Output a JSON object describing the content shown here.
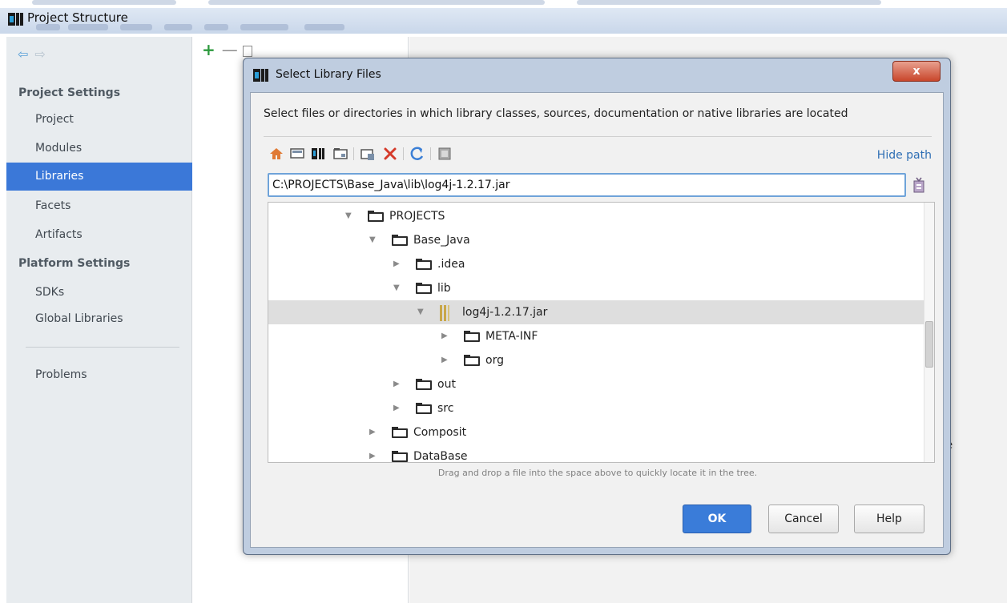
{
  "window": {
    "title": "Project Structure"
  },
  "sidebar": {
    "project_settings_header": "Project Settings",
    "platform_settings_header": "Platform Settings",
    "items": [
      {
        "label": "Project"
      },
      {
        "label": "Modules"
      },
      {
        "label": "Libraries",
        "selected": true
      },
      {
        "label": "Facets"
      },
      {
        "label": "Artifacts"
      },
      {
        "label": "SDKs"
      },
      {
        "label": "Global Libraries"
      },
      {
        "label": "Problems"
      }
    ]
  },
  "right_panel": {
    "partial_text": "re"
  },
  "dialog": {
    "title": "Select Library Files",
    "close_label": "x",
    "description": "Select files or directories in which library classes, sources, documentation or native libraries are located",
    "toolbar_icons": [
      "home-icon",
      "desktop-icon",
      "project-icon",
      "module-icon",
      "new-folder-icon",
      "delete-icon",
      "refresh-icon",
      "show-hidden-icon"
    ],
    "hide_path_label": "Hide path",
    "path_value": "C:\\PROJECTS\\Base_Java\\lib\\log4j-1.2.17.jar",
    "tree": [
      {
        "label": "PROJECTS",
        "icon": "folder",
        "expanded": true
      },
      {
        "label": "Base_Java",
        "icon": "folder",
        "expanded": true
      },
      {
        "label": ".idea",
        "icon": "folder",
        "expanded": false
      },
      {
        "label": "lib",
        "icon": "folder",
        "expanded": true
      },
      {
        "label": "log4j-1.2.17.jar",
        "icon": "jar",
        "expanded": true,
        "selected": true
      },
      {
        "label": "META-INF",
        "icon": "folder",
        "expanded": false
      },
      {
        "label": "org",
        "icon": "folder",
        "expanded": false
      },
      {
        "label": "out",
        "icon": "folder",
        "expanded": false
      },
      {
        "label": "src",
        "icon": "folder",
        "expanded": false
      },
      {
        "label": "Composit",
        "icon": "folder",
        "expanded": false
      },
      {
        "label": "DataBase",
        "icon": "folder",
        "expanded": false
      }
    ],
    "hint": "Drag and drop a file into the space above to quickly locate it in the tree.",
    "ok_label": "OK",
    "cancel_label": "Cancel",
    "help_label": "Help"
  },
  "colors": {
    "accent": "#3b78d8",
    "close": "#c9462b",
    "link": "#2f6fb5"
  }
}
